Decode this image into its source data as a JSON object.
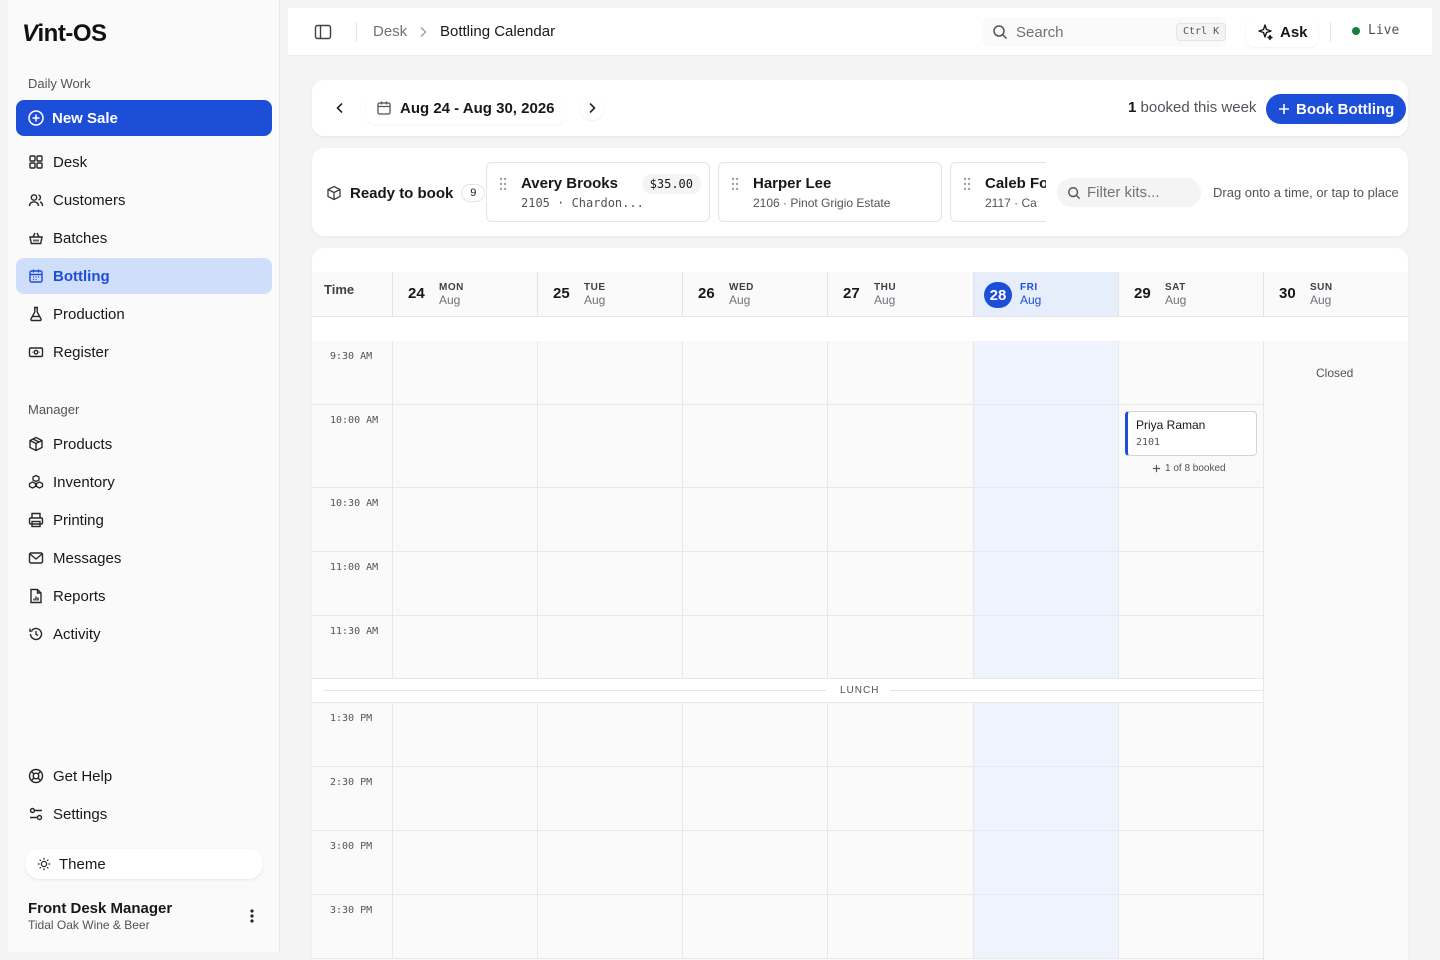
{
  "sidebar": {
    "logo": "Vint-OS",
    "daily_label": "Daily Work",
    "new_sale": "New Sale",
    "daily_items": [
      {
        "label": "Desk",
        "icon": "grid-icon"
      },
      {
        "label": "Customers",
        "icon": "users-icon"
      },
      {
        "label": "Batches",
        "icon": "basket-icon"
      },
      {
        "label": "Bottling",
        "icon": "calendar-icon"
      },
      {
        "label": "Production",
        "icon": "flask-icon"
      },
      {
        "label": "Register",
        "icon": "register-icon"
      }
    ],
    "manager_label": "Manager",
    "manager_items": [
      {
        "label": "Products",
        "icon": "box-icon"
      },
      {
        "label": "Inventory",
        "icon": "boxes-icon"
      },
      {
        "label": "Printing",
        "icon": "printer-icon"
      },
      {
        "label": "Messages",
        "icon": "mail-icon"
      },
      {
        "label": "Reports",
        "icon": "report-icon"
      },
      {
        "label": "Activity",
        "icon": "history-icon"
      }
    ],
    "help": "Get Help",
    "settings": "Settings",
    "theme": "Theme",
    "user_name": "Front Desk Manager",
    "user_org": "Tidal Oak Wine & Beer"
  },
  "topbar": {
    "crumb_root": "Desk",
    "crumb_current": "Bottling Calendar",
    "search_placeholder": "Search",
    "search_shortcut": "Ctrl K",
    "ask": "Ask",
    "status": "Live"
  },
  "week": {
    "range": "Aug 24 - Aug 30, 2026",
    "booked_count": "1",
    "booked_suffix": "booked this week",
    "book_button": "Book Bottling"
  },
  "ready": {
    "label": "Ready to book",
    "count": "9",
    "kits": [
      {
        "name": "Avery Brooks",
        "meta": "2105 · Chardon...",
        "price": "$35.00"
      },
      {
        "name": "Harper Lee",
        "meta": "2106 · Pinot Grigio Estate",
        "price": ""
      },
      {
        "name": "Caleb Fo",
        "meta": "2117 · Ca",
        "price": ""
      }
    ],
    "filter_placeholder": "Filter kits...",
    "hint": "Drag onto a time, or tap to place"
  },
  "calendar": {
    "time_header": "Time",
    "days": [
      {
        "num": "24",
        "dow": "MON",
        "mon": "Aug"
      },
      {
        "num": "25",
        "dow": "TUE",
        "mon": "Aug"
      },
      {
        "num": "26",
        "dow": "WED",
        "mon": "Aug"
      },
      {
        "num": "27",
        "dow": "THU",
        "mon": "Aug"
      },
      {
        "num": "28",
        "dow": "FRI",
        "mon": "Aug"
      },
      {
        "num": "29",
        "dow": "SAT",
        "mon": "Aug"
      },
      {
        "num": "30",
        "dow": "SUN",
        "mon": "Aug"
      }
    ],
    "today_index": 4,
    "morning_slots": [
      "9:30 AM",
      "10:00 AM",
      "10:30 AM",
      "11:00 AM",
      "11:30 AM"
    ],
    "lunch": "LUNCH",
    "afternoon_slots": [
      "1:30 PM",
      "2:30 PM",
      "3:00 PM",
      "3:30 PM"
    ],
    "closed": "Closed",
    "appointment": {
      "name": "Priya Raman",
      "id": "2101",
      "capacity": "1 of 8 booked",
      "day": "SAT",
      "time": "10:00 AM"
    }
  },
  "colors": {
    "accent": "#1d4ed8",
    "active_bg": "#cfdffb",
    "today_bg": "#eef3fd",
    "live": "#15803d"
  }
}
